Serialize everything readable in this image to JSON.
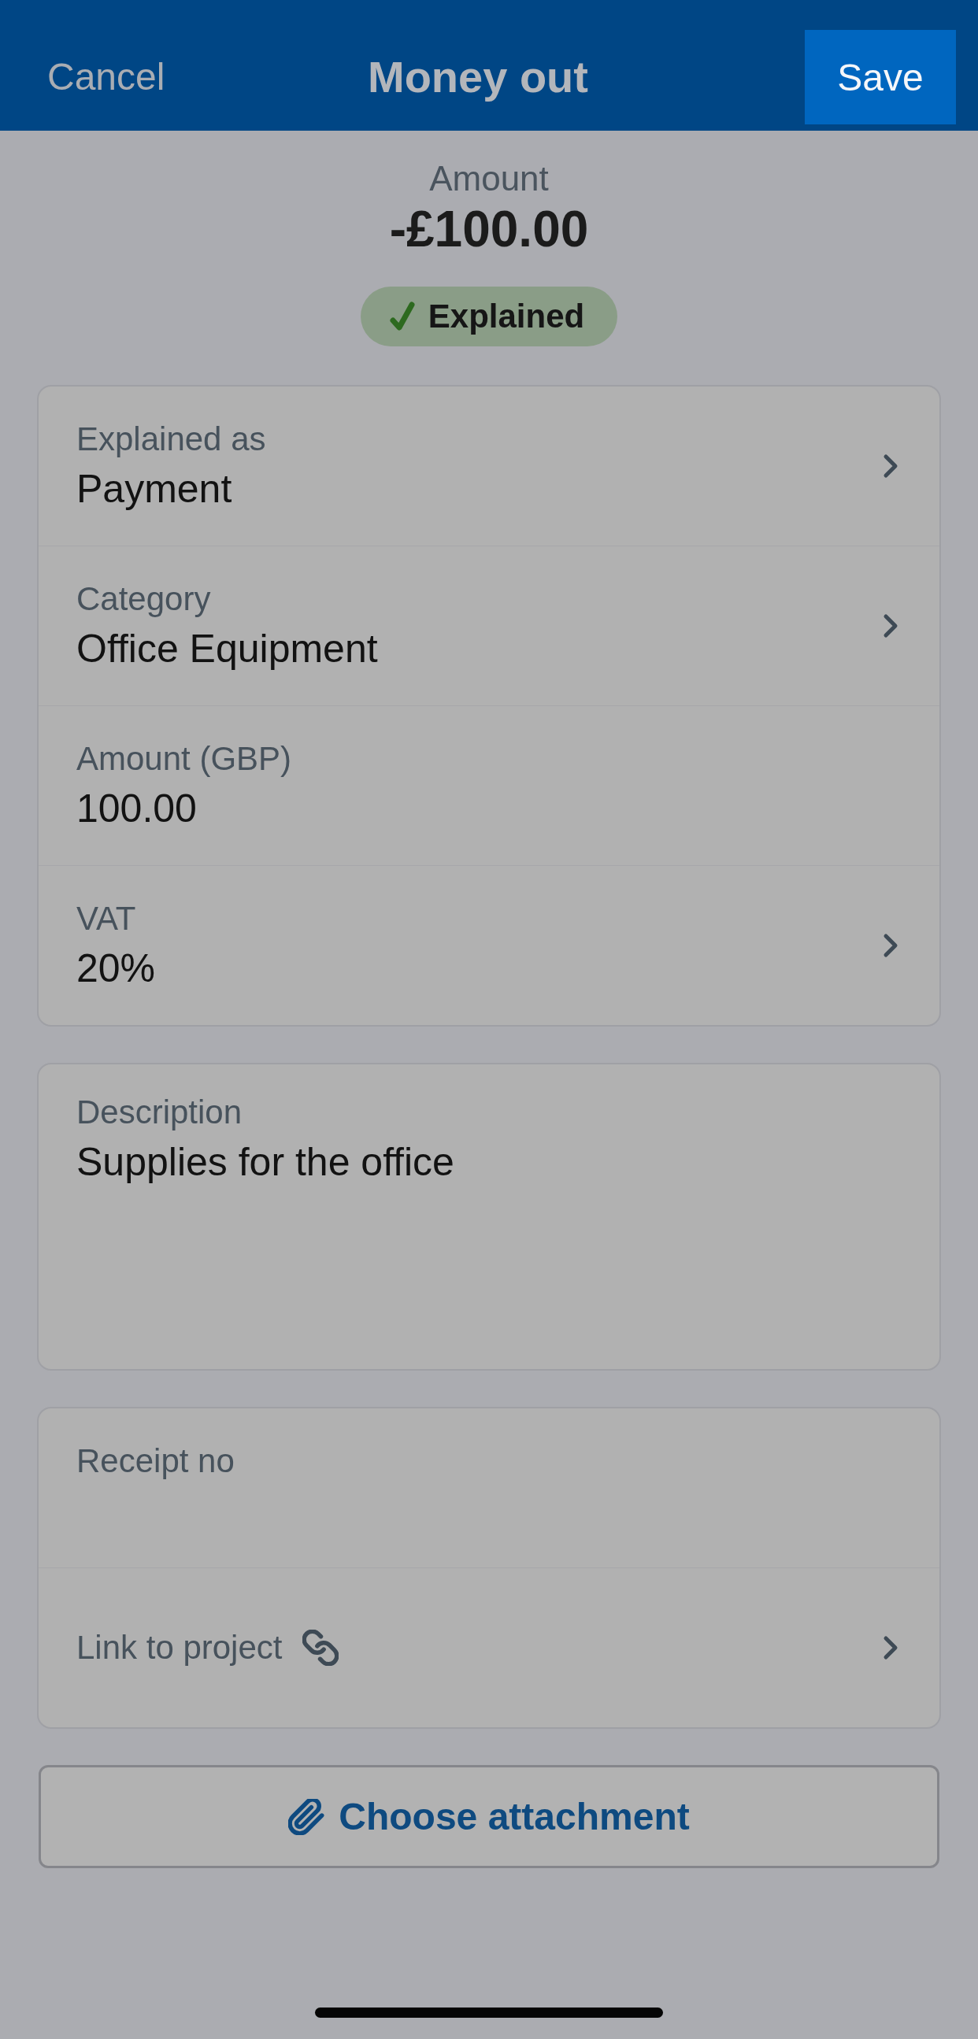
{
  "header": {
    "cancel": "Cancel",
    "title": "Money out",
    "save": "Save"
  },
  "summary": {
    "label": "Amount",
    "amount": "-£100.00",
    "status": "Explained"
  },
  "details": [
    {
      "kind": "select",
      "label": "Explained as",
      "value": "Payment"
    },
    {
      "kind": "select",
      "label": "Category",
      "value": "Office Equipment"
    },
    {
      "kind": "input",
      "label": "Amount (GBP)",
      "value": "100.00"
    },
    {
      "kind": "select",
      "label": "VAT",
      "value": "20%"
    }
  ],
  "description": {
    "label": "Description",
    "value": "Supplies for the office"
  },
  "extras": [
    {
      "kind": "input",
      "label": "Receipt no"
    },
    {
      "kind": "link",
      "label": "Link to project"
    }
  ],
  "attachment_button": "Choose attachment"
}
